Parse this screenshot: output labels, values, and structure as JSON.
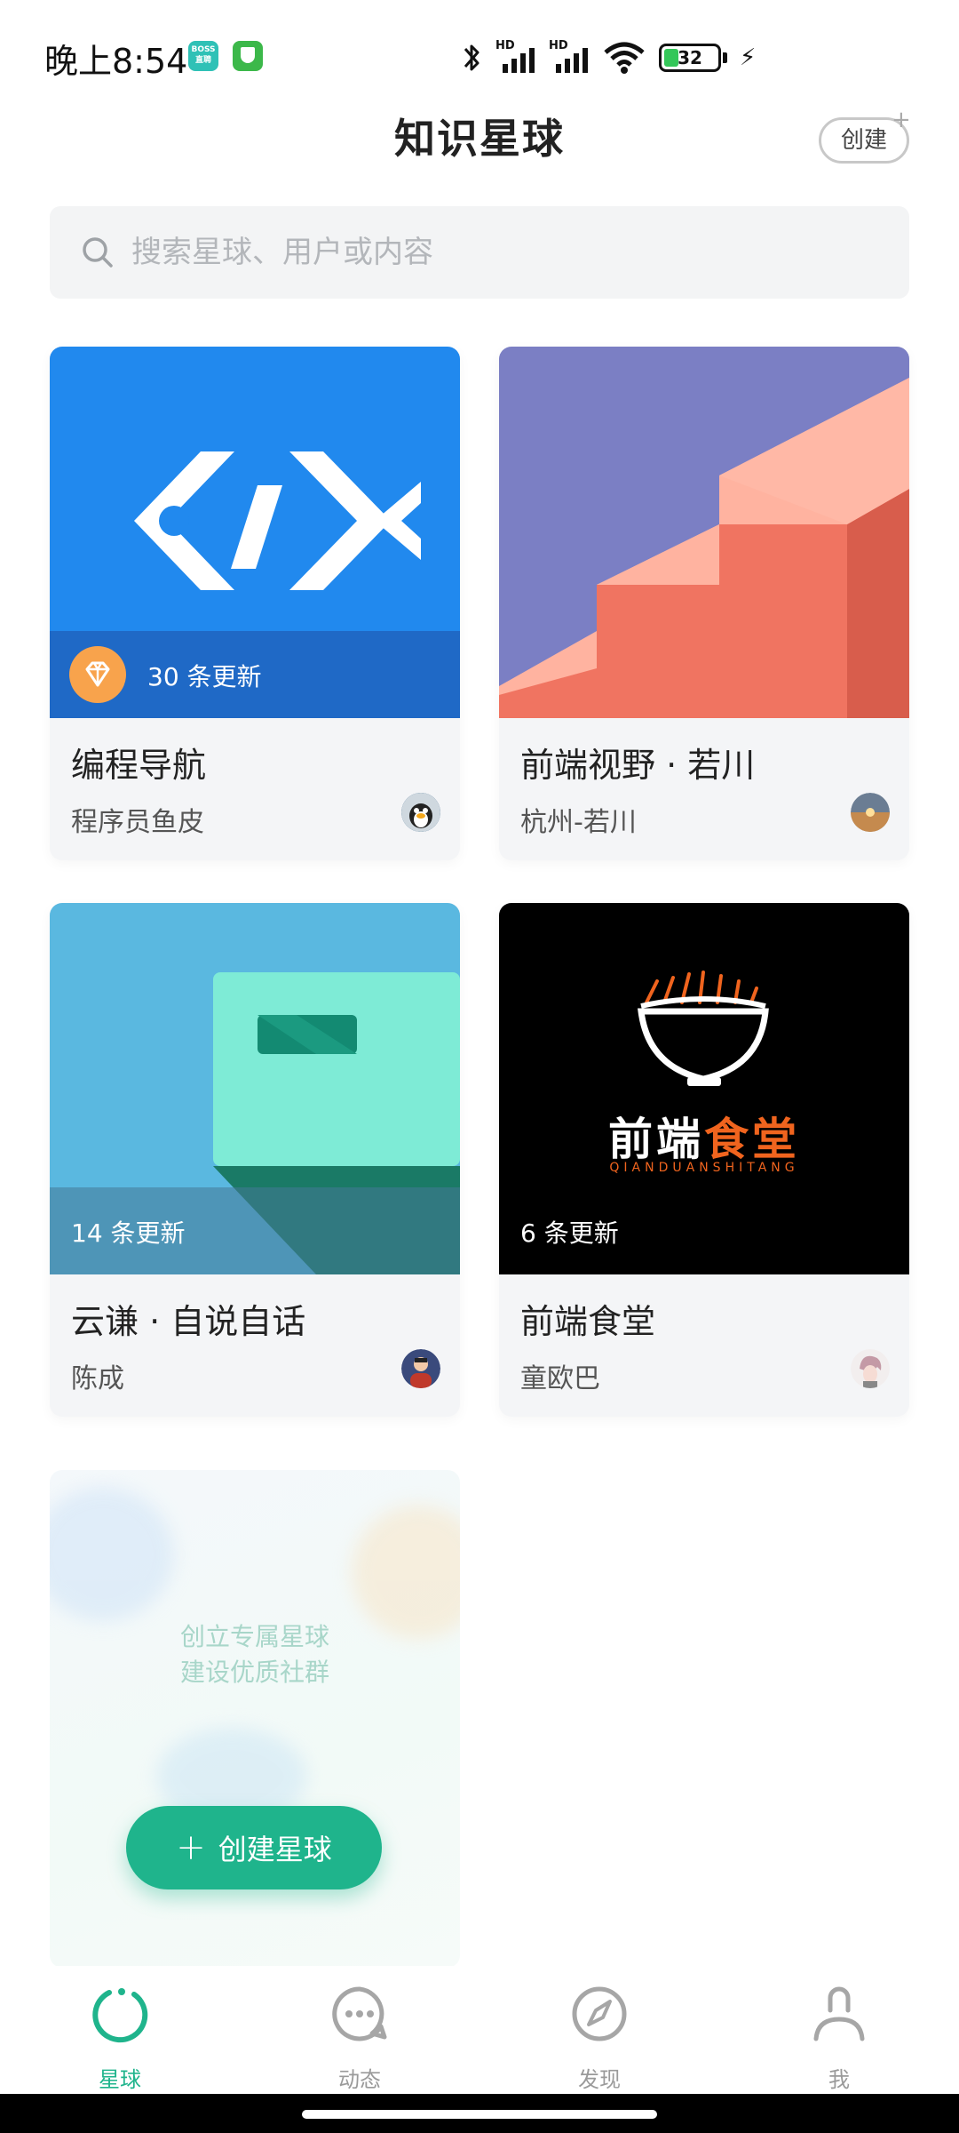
{
  "status": {
    "time": "晚上8:54",
    "boss_badge": "BOSS 直聘",
    "hd1": "HD",
    "hd2": "HD",
    "battery": "32"
  },
  "header": {
    "title": "知识星球",
    "create_label": "创建"
  },
  "search": {
    "placeholder": "搜索星球、用户或内容"
  },
  "planets": [
    {
      "name": "编程导航",
      "owner": "程序员鱼皮",
      "update": "30 条更新",
      "has_diamond": true
    },
    {
      "name": "前端视野 · 若川",
      "owner": "杭州-若川",
      "update": ""
    },
    {
      "name": "云谦 · 自说自话",
      "owner": "陈成",
      "update": "14 条更新"
    },
    {
      "name": "前端食堂",
      "owner": "童欧巴",
      "update": "6 条更新",
      "logo_text_white": "前端",
      "logo_text_orange": "食堂",
      "logo_subtitle": "QIANDUANSHITANG"
    }
  ],
  "create_card": {
    "line1": "创立专属星球",
    "line2": "建设优质社群",
    "button_label": "创建星球",
    "plus": "+"
  },
  "nav": [
    {
      "label": "星球",
      "icon": "planet-icon",
      "active": true
    },
    {
      "label": "动态",
      "icon": "chat-bubble-icon",
      "active": false
    },
    {
      "label": "发现",
      "icon": "compass-icon",
      "active": false
    },
    {
      "label": "我",
      "icon": "person-icon",
      "active": false
    }
  ],
  "colors": {
    "accent": "#1fb48c",
    "card_bg": "#f4f5f7",
    "blue_cover": "#2189ee",
    "purple_cover": "#7b7fc4",
    "teal_cover": "#5ab8e0",
    "black_cover": "#000000",
    "orange": "#f0641e"
  }
}
